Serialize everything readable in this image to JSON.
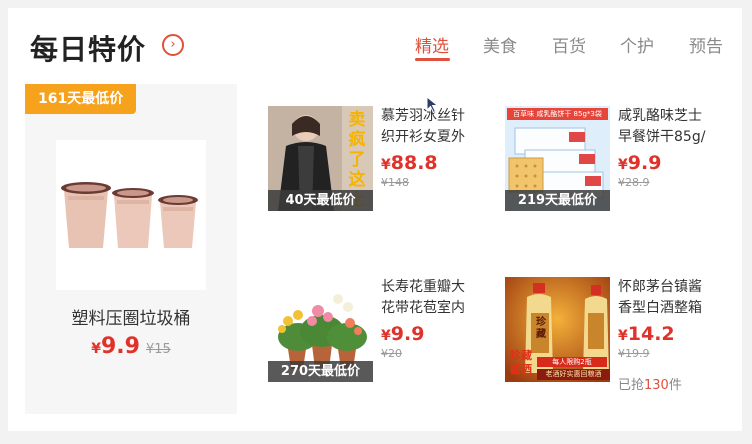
{
  "header": {
    "title": "每日特价",
    "arrow_icon": "chevron-right-circle-icon",
    "tabs": [
      {
        "label": "精选",
        "active": true
      },
      {
        "label": "美食",
        "active": false
      },
      {
        "label": "百货",
        "active": false
      },
      {
        "label": "个护",
        "active": false
      },
      {
        "label": "预告",
        "active": false
      }
    ]
  },
  "featured": {
    "badge": "161天最低价",
    "name": "塑料压圈垃圾桶",
    "currency": "¥",
    "price": "9.9",
    "original_price": "¥15"
  },
  "items": [
    {
      "name": "慕芳羽冰丝针织开衫女夏外",
      "currency": "¥",
      "price": "88.8",
      "original_price": "¥148",
      "badge": "40天最低价",
      "promo_text": "卖疯了这上"
    },
    {
      "name": "咸乳酪味芝士早餐饼干85g/",
      "currency": "¥",
      "price": "9.9",
      "original_price": "¥28.9",
      "badge": "219天最低价",
      "package_text": "百草味 咸乳酪饼干 85g*3袋"
    },
    {
      "name": "长寿花重瓣大花带花苞室内",
      "currency": "¥",
      "price": "9.9",
      "original_price": "¥20",
      "badge": "270天最低价"
    },
    {
      "name": "怀郎茅台镇酱香型白酒整箱",
      "currency": "¥",
      "price": "14.2",
      "original_price": "¥19.9",
      "sold_prefix": "已抢",
      "sold_count": "130",
      "sold_suffix": "件",
      "promo_line1": "珍藏",
      "promo_line2": "酱酒",
      "promo_line3": "每人限购2瓶",
      "promo_line4": "老酒好实惠回粮酒",
      "bottle_label": "珍藏"
    }
  ],
  "colors": {
    "accent": "#e0503a",
    "price": "#e0322a",
    "badge_orange": "#f6a21c"
  }
}
